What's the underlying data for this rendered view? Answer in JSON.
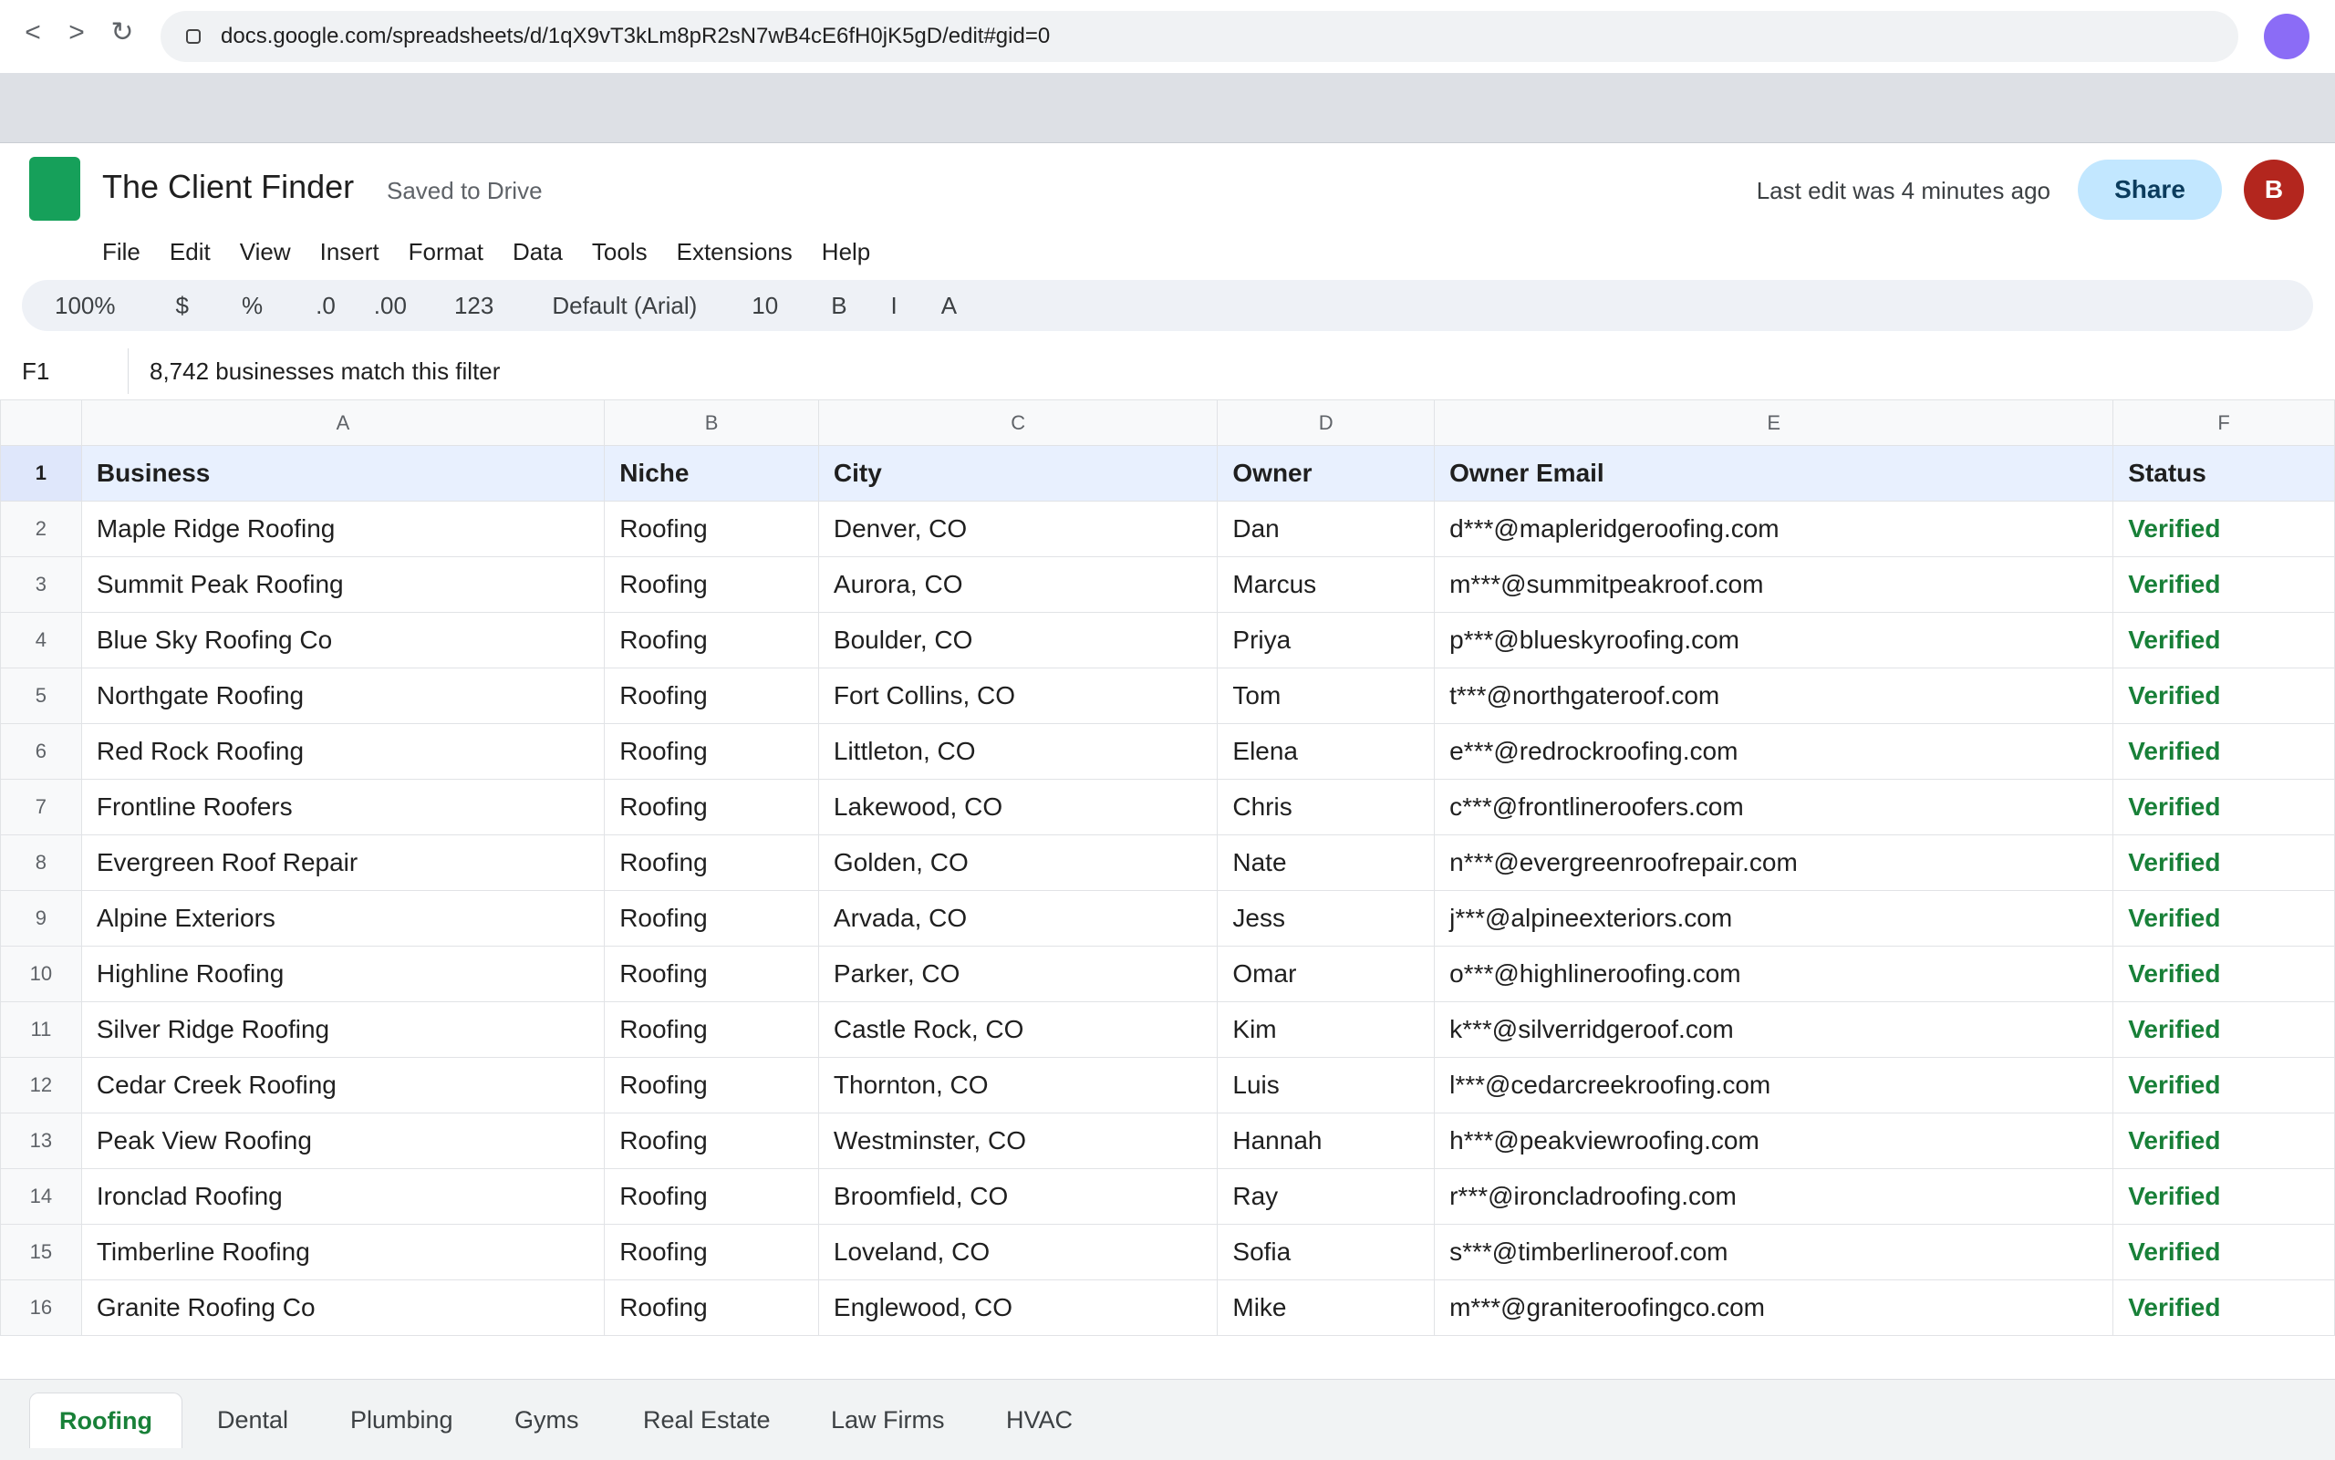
{
  "browser": {
    "back_glyph": "<",
    "forward_glyph": ">",
    "reload_glyph": "↻",
    "url": "docs.google.com/spreadsheets/d/1qX9vT3kLm8pR2sN7wB4cE6fH0jK5gD/edit#gid=0",
    "profile_color": "#8b6cf6"
  },
  "doc": {
    "title": "The Client Finder",
    "saved_status": "Saved to Drive",
    "last_edit": "Last edit was 4 minutes ago",
    "share_label": "Share",
    "avatar_initial": "B",
    "logo_color": "#16a05a"
  },
  "menu": [
    "File",
    "Edit",
    "View",
    "Insert",
    "Format",
    "Data",
    "Tools",
    "Extensions",
    "Help"
  ],
  "toolbar": [
    "100%",
    "$",
    "%",
    ".0",
    ".00",
    "123",
    "Default (Arial)",
    "10",
    "B",
    "I",
    "A"
  ],
  "formula_bar": {
    "cell_ref": "F1",
    "content": "8,742 businesses match this filter"
  },
  "columns": [
    "A",
    "B",
    "C",
    "D",
    "E",
    "F"
  ],
  "header_row": {
    "num": "1",
    "cells": [
      "Business",
      "Niche",
      "City",
      "Owner",
      "Owner Email",
      "Status"
    ]
  },
  "rows": [
    {
      "num": "2",
      "cells": [
        "Maple Ridge Roofing",
        "Roofing",
        "Denver, CO",
        "Dan",
        "d***@mapleridgeroofing.com",
        "Verified"
      ]
    },
    {
      "num": "3",
      "cells": [
        "Summit Peak Roofing",
        "Roofing",
        "Aurora, CO",
        "Marcus",
        "m***@summitpeakroof.com",
        "Verified"
      ]
    },
    {
      "num": "4",
      "cells": [
        "Blue Sky Roofing Co",
        "Roofing",
        "Boulder, CO",
        "Priya",
        "p***@blueskyroofing.com",
        "Verified"
      ]
    },
    {
      "num": "5",
      "cells": [
        "Northgate Roofing",
        "Roofing",
        "Fort Collins, CO",
        "Tom",
        "t***@northgateroof.com",
        "Verified"
      ]
    },
    {
      "num": "6",
      "cells": [
        "Red Rock Roofing",
        "Roofing",
        "Littleton, CO",
        "Elena",
        "e***@redrockroofing.com",
        "Verified"
      ]
    },
    {
      "num": "7",
      "cells": [
        "Frontline Roofers",
        "Roofing",
        "Lakewood, CO",
        "Chris",
        "c***@frontlineroofers.com",
        "Verified"
      ]
    },
    {
      "num": "8",
      "cells": [
        "Evergreen Roof Repair",
        "Roofing",
        "Golden, CO",
        "Nate",
        "n***@evergreenroofrepair.com",
        "Verified"
      ]
    },
    {
      "num": "9",
      "cells": [
        "Alpine Exteriors",
        "Roofing",
        "Arvada, CO",
        "Jess",
        "j***@alpineexteriors.com",
        "Verified"
      ]
    },
    {
      "num": "10",
      "cells": [
        "Highline Roofing",
        "Roofing",
        "Parker, CO",
        "Omar",
        "o***@highlineroofing.com",
        "Verified"
      ]
    },
    {
      "num": "11",
      "cells": [
        "Silver Ridge Roofing",
        "Roofing",
        "Castle Rock, CO",
        "Kim",
        "k***@silverridgeroof.com",
        "Verified"
      ]
    },
    {
      "num": "12",
      "cells": [
        "Cedar Creek Roofing",
        "Roofing",
        "Thornton, CO",
        "Luis",
        "l***@cedarcreekroofing.com",
        "Verified"
      ]
    },
    {
      "num": "13",
      "cells": [
        "Peak View Roofing",
        "Roofing",
        "Westminster, CO",
        "Hannah",
        "h***@peakviewroofing.com",
        "Verified"
      ]
    },
    {
      "num": "14",
      "cells": [
        "Ironclad Roofing",
        "Roofing",
        "Broomfield, CO",
        "Ray",
        "r***@ironcladroofing.com",
        "Verified"
      ]
    },
    {
      "num": "15",
      "cells": [
        "Timberline Roofing",
        "Roofing",
        "Loveland, CO",
        "Sofia",
        "s***@timberlineroof.com",
        "Verified"
      ]
    },
    {
      "num": "16",
      "cells": [
        "Granite Roofing Co",
        "Roofing",
        "Englewood, CO",
        "Mike",
        "m***@graniteroofingco.com",
        "Verified"
      ]
    }
  ],
  "sheet_tabs": [
    {
      "label": "Roofing",
      "active": true
    },
    {
      "label": "Dental",
      "active": false
    },
    {
      "label": "Plumbing",
      "active": false
    },
    {
      "label": "Gyms",
      "active": false
    },
    {
      "label": "Real Estate",
      "active": false
    },
    {
      "label": "Law Firms",
      "active": false
    },
    {
      "label": "HVAC",
      "active": false
    }
  ],
  "colors": {
    "status_verified": "#188038",
    "share_bg": "#c2e7ff",
    "avatar_bg": "#b3261e",
    "header_row_bg": "#e8f0fe"
  }
}
